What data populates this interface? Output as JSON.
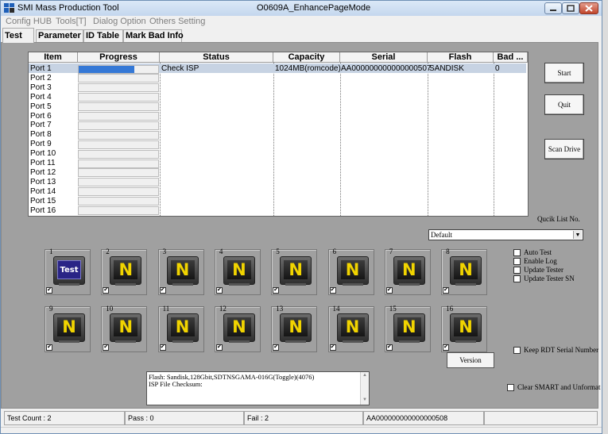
{
  "window": {
    "app_title": "SMI Mass Production Tool",
    "title": "O0609A_EnhancePageMode"
  },
  "menu": [
    "Config HUB",
    "Tools[T]",
    "Dialog Option",
    "Others Setting"
  ],
  "tabs": [
    "Test",
    "Parameter",
    "ID Table",
    "Mark Bad Info"
  ],
  "port_table": {
    "columns": [
      "Item",
      "Progress",
      "Status",
      "Capacity",
      "Serial",
      "Flash",
      "Bad ..."
    ],
    "ports": [
      "Port 1",
      "Port 2",
      "Port 3",
      "Port 4",
      "Port 5",
      "Port 6",
      "Port 7",
      "Port 8",
      "Port 9",
      "Port 10",
      "Port 11",
      "Port 12",
      "Port 13",
      "Port 14",
      "Port 15",
      "Port 16"
    ],
    "row1": {
      "status": "Check ISP",
      "capacity": "1024MB(romcode)",
      "serial": "AA000000000000000507",
      "flash": "SANDISK",
      "bad": "0",
      "progress_fraction": 0.7
    }
  },
  "buttons": {
    "start": "Start",
    "quit": "Quit",
    "scan_drive": "Scan Drive",
    "version": "Version"
  },
  "quick_list": {
    "label": "Qucik List No.",
    "value": "Default"
  },
  "slots": [
    {
      "num": "1",
      "screen": "Test"
    },
    {
      "num": "2",
      "screen": "N"
    },
    {
      "num": "3",
      "screen": "N"
    },
    {
      "num": "4",
      "screen": "N"
    },
    {
      "num": "5",
      "screen": "N"
    },
    {
      "num": "6",
      "screen": "N"
    },
    {
      "num": "7",
      "screen": "N"
    },
    {
      "num": "8",
      "screen": "N"
    },
    {
      "num": "9",
      "screen": "N"
    },
    {
      "num": "10",
      "screen": "N"
    },
    {
      "num": "11",
      "screen": "N"
    },
    {
      "num": "12",
      "screen": "N"
    },
    {
      "num": "13",
      "screen": "N"
    },
    {
      "num": "14",
      "screen": "N"
    },
    {
      "num": "15",
      "screen": "N"
    },
    {
      "num": "16",
      "screen": "N"
    }
  ],
  "options": {
    "auto_test": "Auto Test",
    "enable_log": "Enable Log",
    "update_tester": "Update Tester",
    "update_tester_sn": "Update Tester SN",
    "keep_rdt": "Keep RDT Serial Number",
    "clear_smart": "Clear SMART and Unformat"
  },
  "log": {
    "line1": "Flash: Sandisk,128Gbit,SDTNSGAMA-016G(Toggle)(4076)",
    "line2": "ISP File Checksum:"
  },
  "status": {
    "test_count": "Test Count : 2",
    "pass": "Pass : 0",
    "fail": "Fail : 2",
    "serial": "AA000000000000000508"
  },
  "colors": {
    "progress": "#3478d6",
    "selected_row": "#c7d3e3",
    "n_screen_text": "#f1d400",
    "test_screen": "#2a2486"
  }
}
